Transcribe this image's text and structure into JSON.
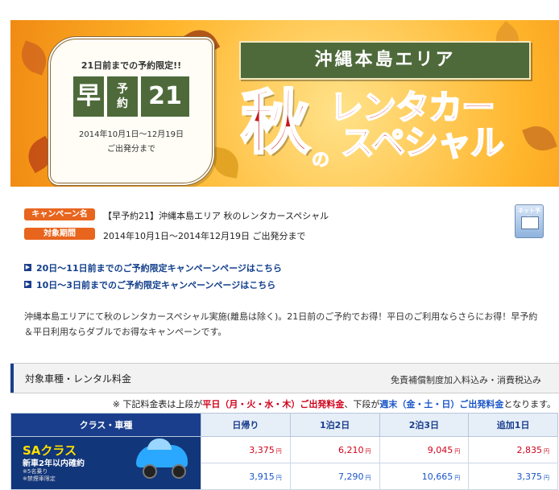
{
  "banner": {
    "limit_label": "21日前までの予約限定!!",
    "chip1": "早",
    "chip2": "予\n約",
    "chip3": "21",
    "period": "2014年10月1日～12月19日",
    "period_sub": "ご出発分まで",
    "area": "沖縄本島エリア",
    "aki": "秋",
    "no": "の",
    "title_line1": "レンタカー",
    "title_line2": "スペシャル"
  },
  "campaign": {
    "name_label": "キャンペーン名",
    "name_value": "【早予約21】沖縄本島エリア 秋のレンタカースペシャル",
    "period_label": "対象期間",
    "period_value": "2014年10月1日～2014年12月19日 ご出発分まで",
    "net_button": "ネット予約"
  },
  "links": [
    "20日～11日前までのご予約限定キャンペーンページはこちら",
    "10日～3日前までのご予約限定キャンペーンページはこちら"
  ],
  "description": "沖縄本島エリアにて秋のレンタカースペシャル実施(離島は除く)。21日前のご予約でお得！平日のご利用ならさらにお得！早予約＆平日利用ならダブルでお得なキャンペーンです。",
  "section": {
    "title": "対象車種・レンタル料金",
    "note": "免責補償制度加入料込み・消費税込み"
  },
  "table_note": {
    "prefix": "※ 下記料金表は上段が",
    "weekday": "平日（月・火・水・木）ご出発料金",
    "middle": "、下段が",
    "weekend": "週末（金・土・日）ご出発料金",
    "suffix": "となります。"
  },
  "table": {
    "headers": [
      "クラス・車種",
      "日帰り",
      "1泊2日",
      "2泊3日",
      "追加1日"
    ],
    "car": {
      "class": "SAクラス",
      "sub": "新車2年以内確約",
      "note1": "※5名乗り",
      "note2": "※禁煙車限定"
    },
    "yen": "円",
    "weekday_prices": [
      "3,375",
      "6,210",
      "9,045",
      "2,835"
    ],
    "weekend_prices": [
      "3,915",
      "7,290",
      "10,665",
      "3,375"
    ]
  },
  "colors": {
    "accent_orange": "#e8651d",
    "navy": "#1a3e8c",
    "red": "#d0021b",
    "green": "#4e6a3a"
  }
}
